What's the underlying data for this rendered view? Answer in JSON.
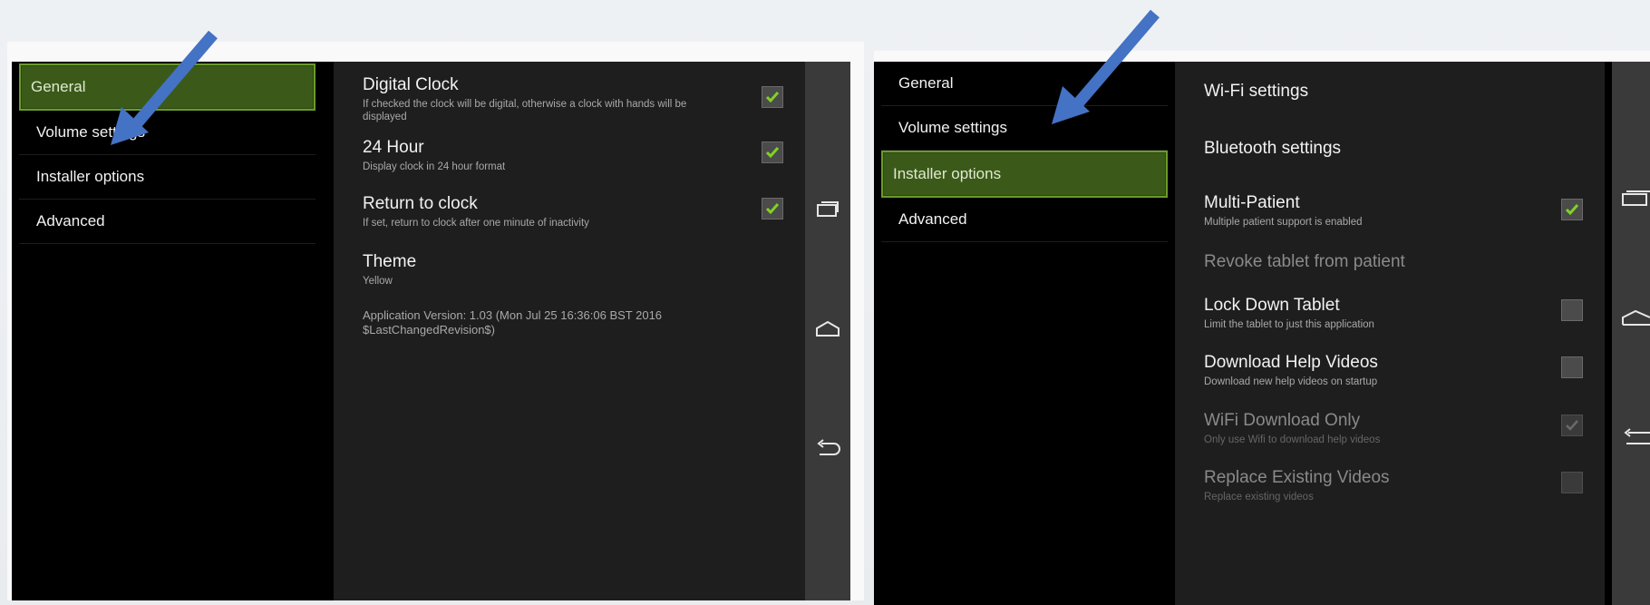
{
  "left_screen": {
    "menu": [
      {
        "label": "General",
        "selected": true
      },
      {
        "label": "Volume settings",
        "selected": false
      },
      {
        "label": "Installer options",
        "selected": false
      },
      {
        "label": "Advanced",
        "selected": false
      }
    ],
    "prefs": [
      {
        "title": "Digital Clock",
        "summary": "If checked the clock will be digital, otherwise a clock with hands will be displayed",
        "checked": true
      },
      {
        "title": "24 Hour",
        "summary": "Display clock in 24 hour format",
        "checked": true
      },
      {
        "title": "Return to clock",
        "summary": "If set, return to clock after one minute of inactivity",
        "checked": true
      },
      {
        "title": "Theme",
        "summary": "Yellow"
      }
    ],
    "version": "Application Version: 1.03 (Mon Jul 25 16:36:06 BST 2016 $LastChangedRevision$)"
  },
  "right_screen": {
    "menu": [
      {
        "label": "General",
        "selected": false
      },
      {
        "label": "Volume settings",
        "selected": false
      },
      {
        "label": "Installer options",
        "selected": true
      },
      {
        "label": "Advanced",
        "selected": false
      }
    ],
    "prefs": [
      {
        "title": "Wi-Fi settings",
        "summary": "",
        "enabled": true
      },
      {
        "title": "Bluetooth settings",
        "summary": "",
        "enabled": true
      },
      {
        "title": "Multi-Patient",
        "summary": "Multiple patient support is enabled",
        "checked": true,
        "enabled": true
      },
      {
        "title": "Revoke tablet from patient",
        "summary": "",
        "enabled": false
      },
      {
        "title": "Lock Down Tablet",
        "summary": "Limit the tablet to just this application",
        "checked": false,
        "enabled": true
      },
      {
        "title": "Download Help Videos",
        "summary": "Download new help videos on startup",
        "checked": false,
        "enabled": true
      },
      {
        "title": "WiFi Download Only",
        "summary": "Only use Wifi to download help videos",
        "checked": true,
        "enabled": false
      },
      {
        "title": "Replace Existing Videos",
        "summary": "Replace existing videos",
        "checked": false,
        "enabled": false
      }
    ]
  },
  "icons": {
    "nav": [
      "recent-apps-icon",
      "home-icon",
      "back-icon"
    ],
    "check": "checkmark-icon",
    "annotation": "arrow-icon"
  },
  "colors": {
    "selected_bg": "#3b5a19",
    "selected_border": "#6b9a2c",
    "check_green": "#7fd321",
    "arrow_blue": "#4472c4"
  }
}
